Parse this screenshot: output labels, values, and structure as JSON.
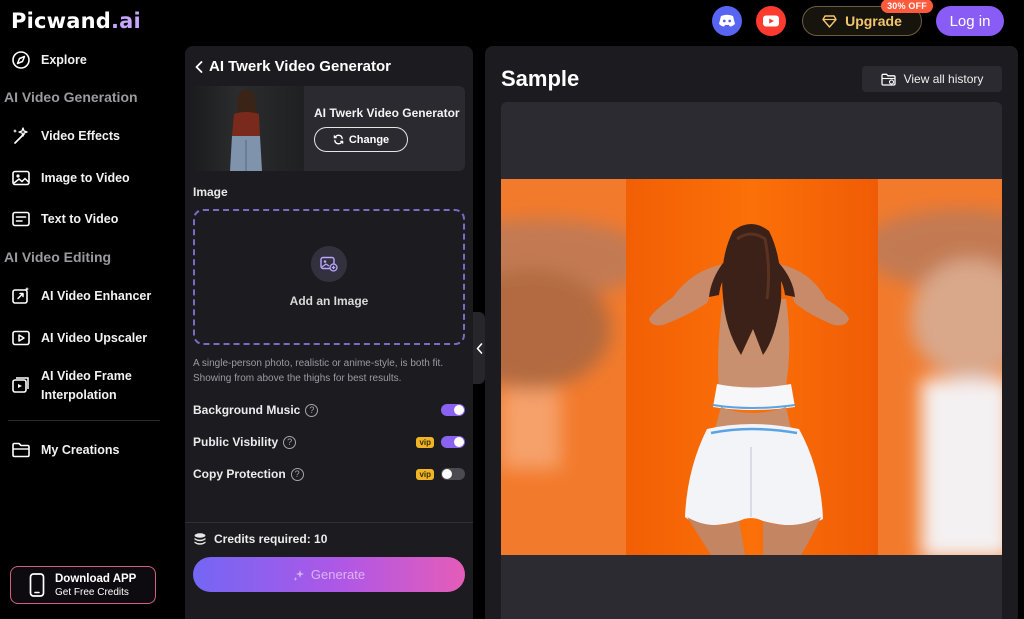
{
  "header": {
    "logo_main": "Picwand",
    "logo_ai": ".ai",
    "icons": [
      "discord-icon",
      "youtube-icon"
    ],
    "upgrade_label": "Upgrade",
    "upgrade_badge": "30% OFF",
    "login_label": "Log in"
  },
  "sidebar": {
    "explore": "Explore",
    "section_generation": "AI Video Generation",
    "video_effects": "Video Effects",
    "image_to_video": "Image to Video",
    "text_to_video": "Text to Video",
    "section_editing": "AI Video Editing",
    "enhancer": "AI Video Enhancer",
    "upscaler": "AI Video Upscaler",
    "frame_interp_line1": "AI Video Frame",
    "frame_interp_line2": "Interpolation",
    "my_creations": "My Creations",
    "download_title": "Download APP",
    "download_sub": "Get Free Credits"
  },
  "panel": {
    "back_title": "AI Twerk Video Generator",
    "model_name": "AI Twerk Video Generator",
    "change_label": "Change",
    "image_label": "Image",
    "upload_label": "Add an Image",
    "hint": "A single-person photo, realistic or anime-style, is both fit. Showing from above the thighs for best results.",
    "options": [
      {
        "label": "Background Music",
        "vip": false,
        "on": true
      },
      {
        "label": "Public Visbility",
        "vip": true,
        "on": true
      },
      {
        "label": "Copy Protection",
        "vip": true,
        "on": false
      }
    ],
    "vip_label": "vip",
    "credits": "Credits required: 10",
    "generate_label": "Generate"
  },
  "sample": {
    "title": "Sample",
    "history_label": "View all history"
  },
  "colors": {
    "accent": "#8a5cf6",
    "upgrade_gold": "#f2c56d",
    "video_orange": "#ff6a00"
  }
}
